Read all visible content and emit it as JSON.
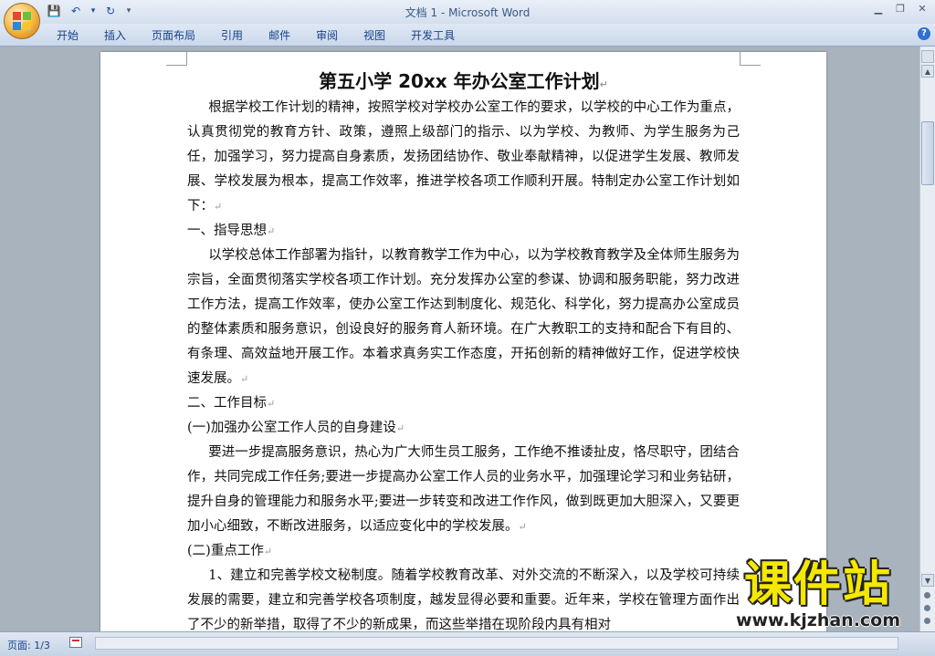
{
  "window": {
    "title": "文档 1 - Microsoft Word",
    "min": "▁",
    "max": "❐",
    "close": "✕"
  },
  "qat": {
    "save": "💾",
    "undo": "↶",
    "undo_dd": "▾",
    "redo": "↻",
    "customize": "▾"
  },
  "tabs": [
    "开始",
    "插入",
    "页面布局",
    "引用",
    "邮件",
    "审阅",
    "视图",
    "开发工具"
  ],
  "help": "?",
  "document": {
    "title": "第五小学 20xx 年办公室工作计划",
    "paragraphs": [
      "根据学校工作计划的精神，按照学校对学校办公室工作的要求，以学校的中心工作为重点，认真贯彻党的教育方针、政策，遵照上级部门的指示、以为学校、为教师、为学生服务为己任，加强学习，努力提高自身素质，发扬团结协作、敬业奉献精神，以促进学生发展、教师发展、学校发展为根本，提高工作效率，推进学校各项工作顺利开展。特制定办公室工作计划如下：",
      "一、指导思想",
      "以学校总体工作部署为指针，以教育教学工作为中心，以为学校教育教学及全体师生服务为宗旨，全面贯彻落实学校各项工作计划。充分发挥办公室的参谋、协调和服务职能，努力改进工作方法，提高工作效率，使办公室工作达到制度化、规范化、科学化，努力提高办公室成员的整体素质和服务意识，创设良好的服务育人新环境。在广大教职工的支持和配合下有目的、有条理、高效益地开展工作。本着求真务实工作态度，开拓创新的精神做好工作，促进学校快速发展。",
      "二、工作目标",
      "(一)加强办公室工作人员的自身建设",
      "要进一步提高服务意识，热心为广大师生员工服务，工作绝不推诿扯皮，恪尽职守，团结合作，共同完成工作任务;要进一步提高办公室工作人员的业务水平，加强理论学习和业务钻研，提升自身的管理能力和服务水平;要进一步转变和改进工作作风，做到既更加大胆深入，又要更加小心细致，不断改进服务，以适应变化中的学校发展。",
      "(二)重点工作",
      "1、建立和完善学校文秘制度。随着学校教育改革、对外交流的不断深入，以及学校可持续发展的需要，建立和完善学校各项制度，越发显得必要和重要。近年来，学校在管理方面作出了不少的新举措，取得了不少的新成果，而这些举措在现阶段内具有相对"
    ],
    "mark": "↵"
  },
  "status": {
    "page": "页面: 1/3"
  },
  "watermark": {
    "text": "课件站",
    "url": "www.kjzhan.com"
  }
}
